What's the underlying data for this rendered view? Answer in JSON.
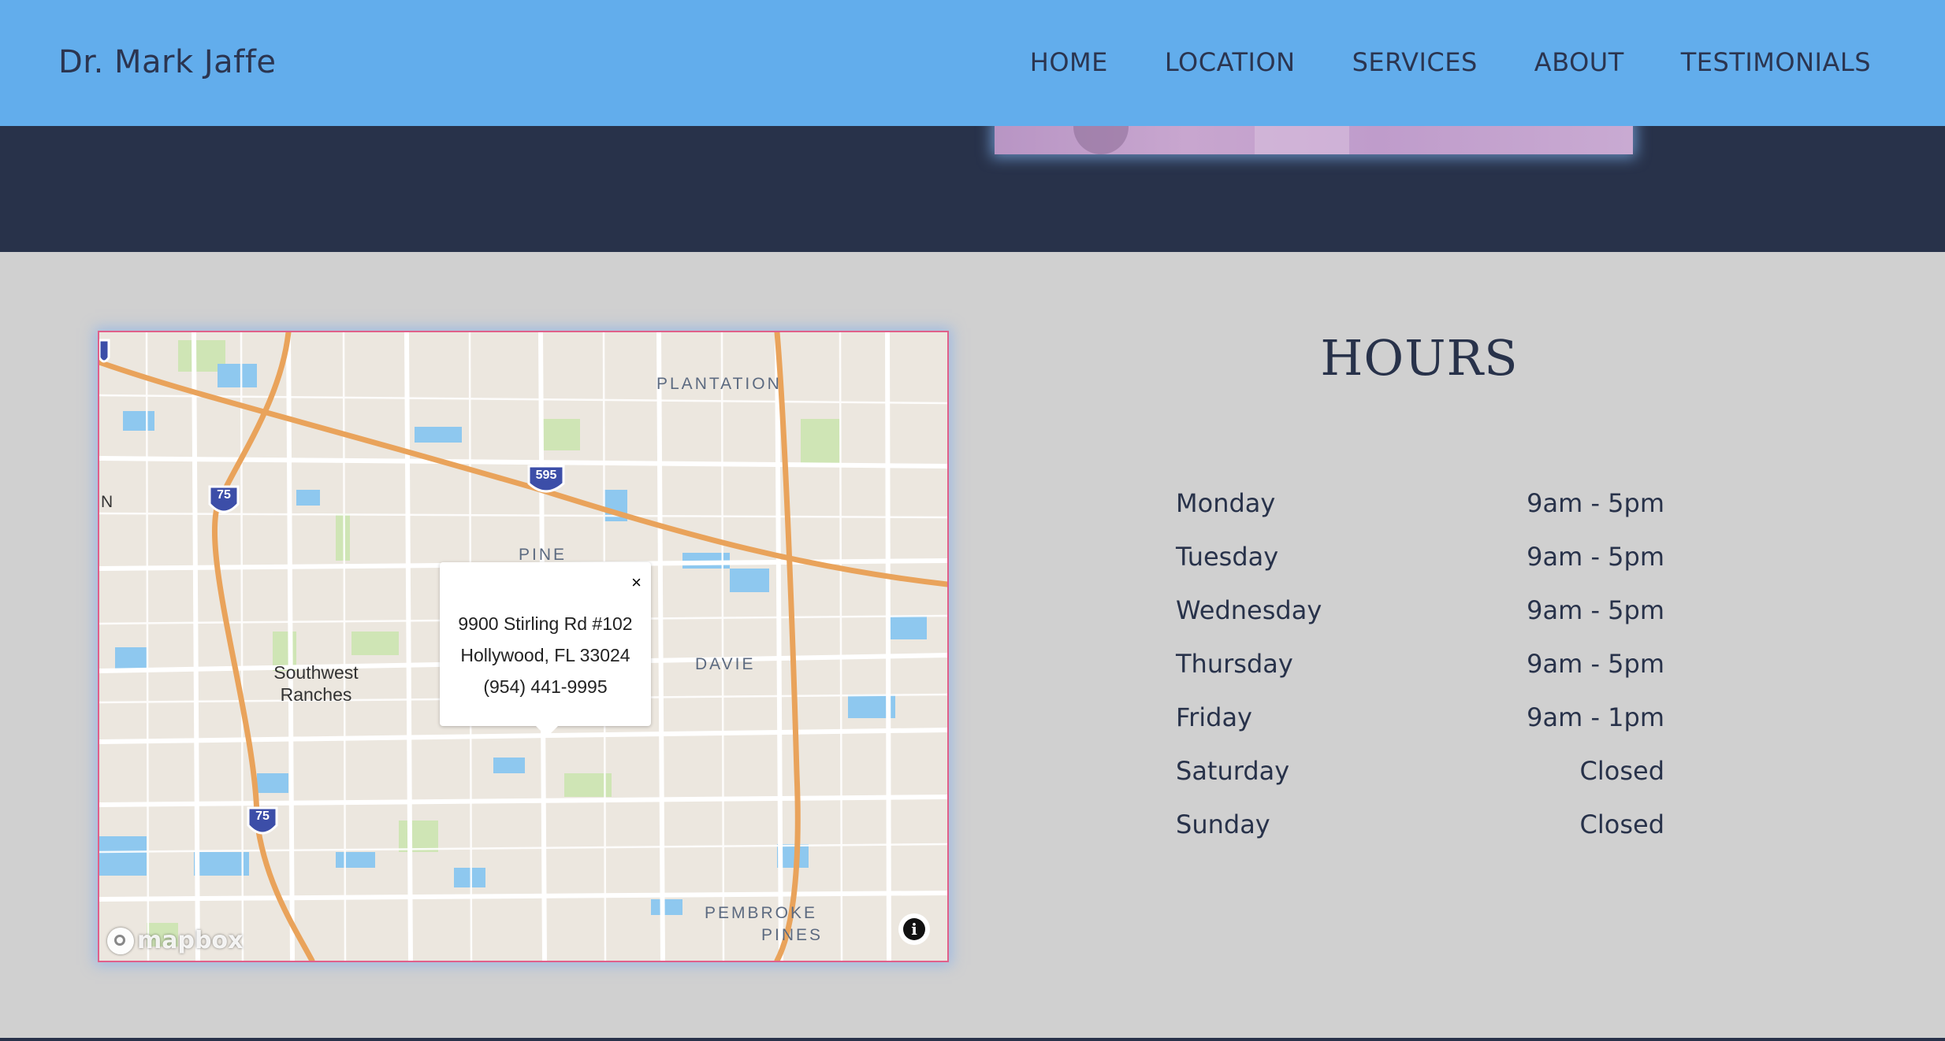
{
  "header": {
    "brand": "Dr. Mark Jaffe",
    "nav": [
      "HOME",
      "LOCATION",
      "SERVICES",
      "ABOUT",
      "TESTIMONIALS"
    ]
  },
  "map": {
    "labels": {
      "plantation": "PLANTATION",
      "pine": "PINE",
      "davie": "DAVIE",
      "pembroke_1": "PEMBROKE",
      "pembroke_2": "PINES",
      "sw_1": "Southwest",
      "sw_2": "Ranches",
      "edge_n": "N"
    },
    "shields": [
      "75",
      "595",
      "75"
    ],
    "popup": {
      "address_line1": "9900 Stirling Rd #102",
      "address_line2": "Hollywood, FL 33024",
      "phone": "(954) 441-9995",
      "close": "×"
    },
    "logo": "mapbox",
    "info_icon": "i"
  },
  "hours": {
    "title": "HOURS",
    "rows": [
      {
        "day": "Monday",
        "time": "9am - 5pm"
      },
      {
        "day": "Tuesday",
        "time": "9am - 5pm"
      },
      {
        "day": "Wednesday",
        "time": "9am - 5pm"
      },
      {
        "day": "Thursday",
        "time": "9am - 5pm"
      },
      {
        "day": "Friday",
        "time": "9am - 1pm"
      },
      {
        "day": "Saturday",
        "time": "Closed"
      },
      {
        "day": "Sunday",
        "time": "Closed"
      }
    ]
  },
  "colors": {
    "header_bg": "#62adec",
    "navy": "#28324a",
    "page_bg": "#d0d0d0",
    "highway": "#e9a35b",
    "water": "#8ec8ef"
  }
}
